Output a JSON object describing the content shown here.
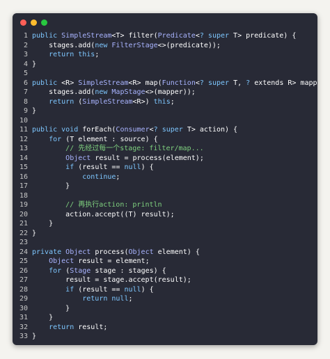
{
  "window": {
    "controls": [
      {
        "name": "close",
        "color": "#ff5f57"
      },
      {
        "name": "minimize",
        "color": "#febc2e"
      },
      {
        "name": "maximize",
        "color": "#28c840"
      }
    ]
  },
  "colors": {
    "background": "#282a36",
    "keyword": "#7ec7ff",
    "type": "#a9b4ff",
    "comment": "#7fd17f",
    "plain": "#ffffff",
    "line_number": "#c7c7c7"
  },
  "code": {
    "lines": [
      {
        "num": "1",
        "tokens": [
          [
            "kw",
            "public "
          ],
          [
            "ty",
            "SimpleStream"
          ],
          [
            "pl",
            "<T> filter("
          ],
          [
            "ty",
            "Predicate"
          ],
          [
            "pl",
            "<"
          ],
          [
            "kw",
            "?"
          ],
          [
            "pl",
            " "
          ],
          [
            "kw",
            "super"
          ],
          [
            "pl",
            " T> predicate) {"
          ]
        ]
      },
      {
        "num": "2",
        "tokens": [
          [
            "pl",
            "    stages.add("
          ],
          [
            "kw",
            "new "
          ],
          [
            "ty",
            "FilterStage"
          ],
          [
            "pl",
            "<>(predicate));"
          ]
        ]
      },
      {
        "num": "3",
        "tokens": [
          [
            "pl",
            "    "
          ],
          [
            "kw",
            "return this"
          ],
          [
            "pl",
            ";"
          ]
        ]
      },
      {
        "num": "4",
        "tokens": [
          [
            "pl",
            "}"
          ]
        ]
      },
      {
        "num": "5",
        "tokens": []
      },
      {
        "num": "6",
        "tokens": [
          [
            "kw",
            "public "
          ],
          [
            "pl",
            "<R> "
          ],
          [
            "ty",
            "SimpleStream"
          ],
          [
            "pl",
            "<R> map("
          ],
          [
            "ty",
            "Function"
          ],
          [
            "pl",
            "<"
          ],
          [
            "kw",
            "?"
          ],
          [
            "pl",
            " "
          ],
          [
            "kw",
            "super"
          ],
          [
            "pl",
            " T, "
          ],
          [
            "kw",
            "?"
          ],
          [
            "pl",
            " extends R> mapper) {"
          ]
        ]
      },
      {
        "num": "7",
        "tokens": [
          [
            "pl",
            "    stages.add("
          ],
          [
            "kw",
            "new "
          ],
          [
            "ty",
            "MapStage"
          ],
          [
            "pl",
            "<>(mapper));"
          ]
        ]
      },
      {
        "num": "8",
        "tokens": [
          [
            "pl",
            "    "
          ],
          [
            "kw",
            "return "
          ],
          [
            "pl",
            "("
          ],
          [
            "ty",
            "SimpleStream"
          ],
          [
            "pl",
            "<R>) "
          ],
          [
            "kw",
            "this"
          ],
          [
            "pl",
            ";"
          ]
        ]
      },
      {
        "num": "9",
        "tokens": [
          [
            "pl",
            "}"
          ]
        ]
      },
      {
        "num": "10",
        "tokens": []
      },
      {
        "num": "11",
        "tokens": [
          [
            "kw",
            "public void "
          ],
          [
            "pl",
            "forEach("
          ],
          [
            "ty",
            "Consumer"
          ],
          [
            "pl",
            "<"
          ],
          [
            "kw",
            "?"
          ],
          [
            "pl",
            " "
          ],
          [
            "kw",
            "super"
          ],
          [
            "pl",
            " T> action) {"
          ]
        ]
      },
      {
        "num": "12",
        "tokens": [
          [
            "pl",
            "    "
          ],
          [
            "kw",
            "for "
          ],
          [
            "pl",
            "(T element : source) {"
          ]
        ]
      },
      {
        "num": "13",
        "tokens": [
          [
            "cm",
            "        // 先经过每一个stage: filter/map..."
          ]
        ]
      },
      {
        "num": "14",
        "tokens": [
          [
            "pl",
            "        "
          ],
          [
            "ty",
            "Object"
          ],
          [
            "pl",
            " result = process(element);"
          ]
        ]
      },
      {
        "num": "15",
        "tokens": [
          [
            "pl",
            "        "
          ],
          [
            "kw",
            "if "
          ],
          [
            "pl",
            "(result == "
          ],
          [
            "kw",
            "null"
          ],
          [
            "pl",
            ") {"
          ]
        ]
      },
      {
        "num": "16",
        "tokens": [
          [
            "pl",
            "            "
          ],
          [
            "kw",
            "continue"
          ],
          [
            "pl",
            ";"
          ]
        ]
      },
      {
        "num": "17",
        "tokens": [
          [
            "pl",
            "        }"
          ]
        ]
      },
      {
        "num": "18",
        "tokens": []
      },
      {
        "num": "19",
        "tokens": [
          [
            "cm",
            "        // 再执行action: println"
          ]
        ]
      },
      {
        "num": "20",
        "tokens": [
          [
            "pl",
            "        action.accept((T) result);"
          ]
        ]
      },
      {
        "num": "21",
        "tokens": [
          [
            "pl",
            "    }"
          ]
        ]
      },
      {
        "num": "22",
        "tokens": [
          [
            "pl",
            "}"
          ]
        ]
      },
      {
        "num": "23",
        "tokens": []
      },
      {
        "num": "24",
        "tokens": [
          [
            "kw",
            "private "
          ],
          [
            "ty",
            "Object"
          ],
          [
            "pl",
            " process("
          ],
          [
            "ty",
            "Object"
          ],
          [
            "pl",
            " element) {"
          ]
        ]
      },
      {
        "num": "25",
        "tokens": [
          [
            "pl",
            "    "
          ],
          [
            "ty",
            "Object"
          ],
          [
            "pl",
            " result = element;"
          ]
        ]
      },
      {
        "num": "26",
        "tokens": [
          [
            "pl",
            "    "
          ],
          [
            "kw",
            "for "
          ],
          [
            "pl",
            "("
          ],
          [
            "ty",
            "Stage"
          ],
          [
            "pl",
            " stage : stages) {"
          ]
        ]
      },
      {
        "num": "27",
        "tokens": [
          [
            "pl",
            "        result = stage.accept(result);"
          ]
        ]
      },
      {
        "num": "28",
        "tokens": [
          [
            "pl",
            "        "
          ],
          [
            "kw",
            "if "
          ],
          [
            "pl",
            "(result == "
          ],
          [
            "kw",
            "null"
          ],
          [
            "pl",
            ") {"
          ]
        ]
      },
      {
        "num": "29",
        "tokens": [
          [
            "pl",
            "            "
          ],
          [
            "kw",
            "return null"
          ],
          [
            "pl",
            ";"
          ]
        ]
      },
      {
        "num": "30",
        "tokens": [
          [
            "pl",
            "        }"
          ]
        ]
      },
      {
        "num": "31",
        "tokens": [
          [
            "pl",
            "    }"
          ]
        ]
      },
      {
        "num": "32",
        "tokens": [
          [
            "pl",
            "    "
          ],
          [
            "kw",
            "return "
          ],
          [
            "pl",
            "result;"
          ]
        ]
      },
      {
        "num": "33",
        "tokens": [
          [
            "pl",
            "}"
          ]
        ]
      }
    ]
  }
}
